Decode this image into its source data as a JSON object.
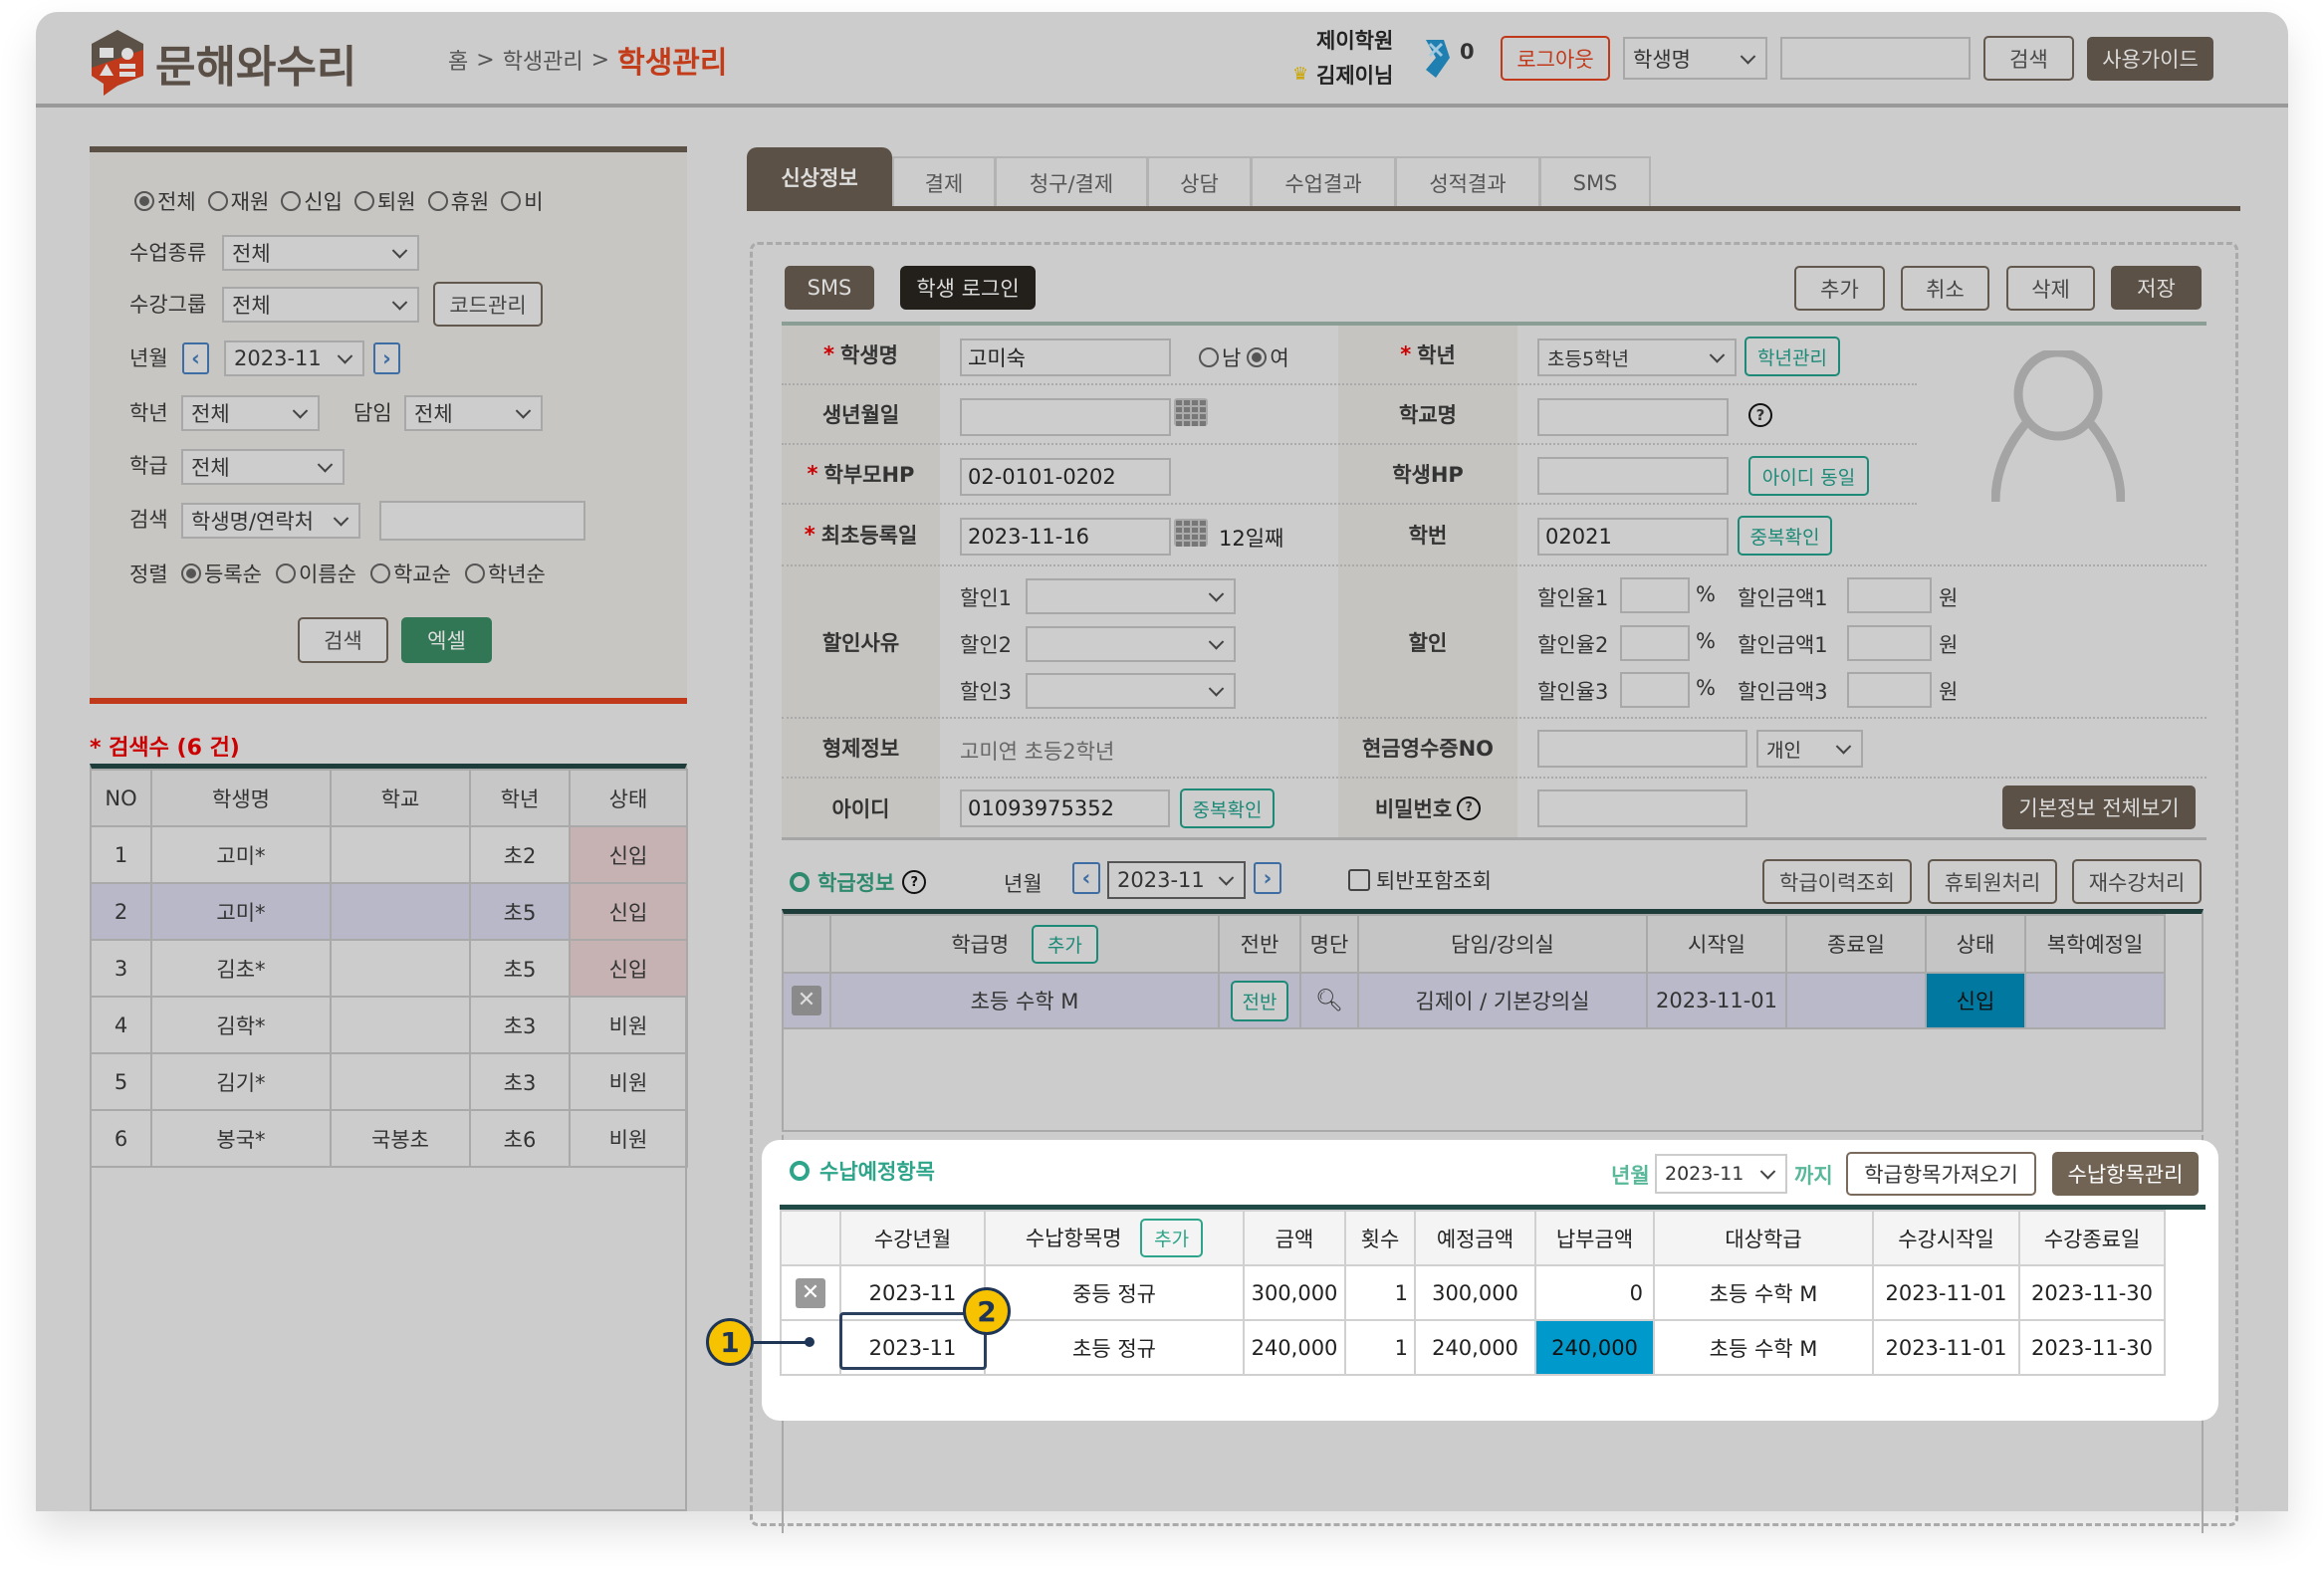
{
  "header": {
    "logo_text": "문해와수리",
    "breadcrumb": [
      "홈",
      "학생관리"
    ],
    "breadcrumb_sep": ">",
    "current_page": "학생관리",
    "academy": "제이학원",
    "user": "김제이님",
    "badge_count": "0",
    "logout": "로그아웃",
    "search_type": "학생명",
    "search_value": "",
    "search_button": "검색",
    "guide_button": "사용가이드"
  },
  "filters": {
    "status_options": [
      "전체",
      "재원",
      "신입",
      "퇴원",
      "휴원",
      "비"
    ],
    "status_selected": "전체",
    "class_type_label": "수업종류",
    "class_type_value": "전체",
    "group_label": "수강그룹",
    "group_value": "전체",
    "code_button": "코드관리",
    "month_label": "년월",
    "month_value": "2023-11",
    "grade_label": "학년",
    "grade_value": "전체",
    "teacher_label": "담임",
    "teacher_value": "전체",
    "class_label": "학급",
    "class_value": "전체",
    "search_label": "검색",
    "search_type": "학생명/연락처",
    "search_value": "",
    "sort_label": "정렬",
    "sort_options": [
      "등록순",
      "이름순",
      "학교순",
      "학년순"
    ],
    "sort_selected": "등록순",
    "search_button": "검색",
    "excel_button": "엑셀"
  },
  "results": {
    "count_label": "* 검색수 (6 건)",
    "columns": [
      "NO",
      "학생명",
      "학교",
      "학년",
      "상태"
    ],
    "rows": [
      {
        "no": "1",
        "name": "고미*",
        "school": "",
        "grade": "초2",
        "status": "신입"
      },
      {
        "no": "2",
        "name": "고미*",
        "school": "",
        "grade": "초5",
        "status": "신입"
      },
      {
        "no": "3",
        "name": "김초*",
        "school": "",
        "grade": "초5",
        "status": "신입"
      },
      {
        "no": "4",
        "name": "김학*",
        "school": "",
        "grade": "초3",
        "status": "비원"
      },
      {
        "no": "5",
        "name": "김기*",
        "school": "",
        "grade": "초3",
        "status": "비원"
      },
      {
        "no": "6",
        "name": "봉국*",
        "school": "국봉초",
        "grade": "초6",
        "status": "비원"
      }
    ]
  },
  "tabs": [
    "신상정보",
    "결제",
    "청구/결제",
    "상담",
    "수업결과",
    "성적결과",
    "SMS"
  ],
  "actions": {
    "sms": "SMS",
    "student_login": "학생 로그인",
    "add": "추가",
    "cancel": "취소",
    "delete": "삭제",
    "save": "저장"
  },
  "form": {
    "name_label": "학생명",
    "name_value": "고미숙",
    "gender_options": [
      "남",
      "여"
    ],
    "gender_selected": "여",
    "grade_label": "학년",
    "grade_value": "초등5학년",
    "grade_manage": "학년관리",
    "birth_label": "생년월일",
    "birth_value": "",
    "school_label": "학교명",
    "school_value": "",
    "parent_hp_label": "학부모HP",
    "parent_hp_value": "02-0101-0202",
    "student_hp_label": "학생HP",
    "student_hp_value": "",
    "same_id_button": "아이디 동일",
    "first_reg_label": "최초등록일",
    "first_reg_value": "2023-11-16",
    "days_label": "12일째",
    "student_no_label": "학번",
    "student_no_value": "02021",
    "dup_check": "중복확인",
    "discount_reason_label": "할인사유",
    "discount_reasons": [
      "할인1",
      "할인2",
      "할인3"
    ],
    "discount_label": "할인",
    "discount_rates": [
      "할인율1",
      "할인율2",
      "할인율3"
    ],
    "discount_amounts": [
      "할인금액1",
      "할인금액1",
      "할인금액3"
    ],
    "percent": "%",
    "won": "원",
    "sibling_label": "형제정보",
    "sibling_value": "고미연 초등2학년",
    "receipt_label": "현금영수증NO",
    "receipt_value": "",
    "receipt_type": "개인",
    "id_label": "아이디",
    "id_value": "01093975352",
    "password_label": "비밀번호",
    "password_value": "",
    "view_all": "기본정보 전체보기"
  },
  "class_info": {
    "title": "학급정보",
    "month_label": "년월",
    "month_value": "2023-11",
    "include_withdrawn": "퇴반포함조회",
    "history_button": "학급이력조회",
    "leave_button": "휴퇴원처리",
    "retake_button": "재수강처리",
    "columns": [
      "학급명",
      "전반",
      "명단",
      "담임/강의실",
      "시작일",
      "종료일",
      "상태",
      "복학예정일"
    ],
    "add_button": "추가",
    "rows": [
      {
        "class": "초등 수학 M",
        "transfer": "전반",
        "teacher_room": "김제이 / 기본강의실",
        "start": "2023-11-01",
        "end": "",
        "status": "신입",
        "return_date": ""
      }
    ]
  },
  "payment": {
    "title": "수납예정항목",
    "month_label": "년월",
    "month_value": "2023-11",
    "until": "까지",
    "import_button": "학급항목가져오기",
    "manage_button": "수납항목관리",
    "add_button": "추가",
    "columns": [
      "수강년월",
      "수납항목명",
      "금액",
      "횟수",
      "예정금액",
      "납부금액",
      "대상학급",
      "수강시작일",
      "수강종료일"
    ],
    "rows": [
      {
        "month": "2023-11",
        "item": "중등 정규",
        "amount": "300,000",
        "count": "1",
        "planned": "300,000",
        "paid": "0",
        "class": "초등 수학 M",
        "start": "2023-11-01",
        "end": "2023-11-30"
      },
      {
        "month": "2023-11",
        "item": "초등 정규",
        "amount": "240,000",
        "count": "1",
        "planned": "240,000",
        "paid": "240,000",
        "class": "초등 수학 M",
        "start": "2023-11-01",
        "end": "2023-11-30"
      }
    ]
  },
  "callouts": [
    "1",
    "2"
  ]
}
